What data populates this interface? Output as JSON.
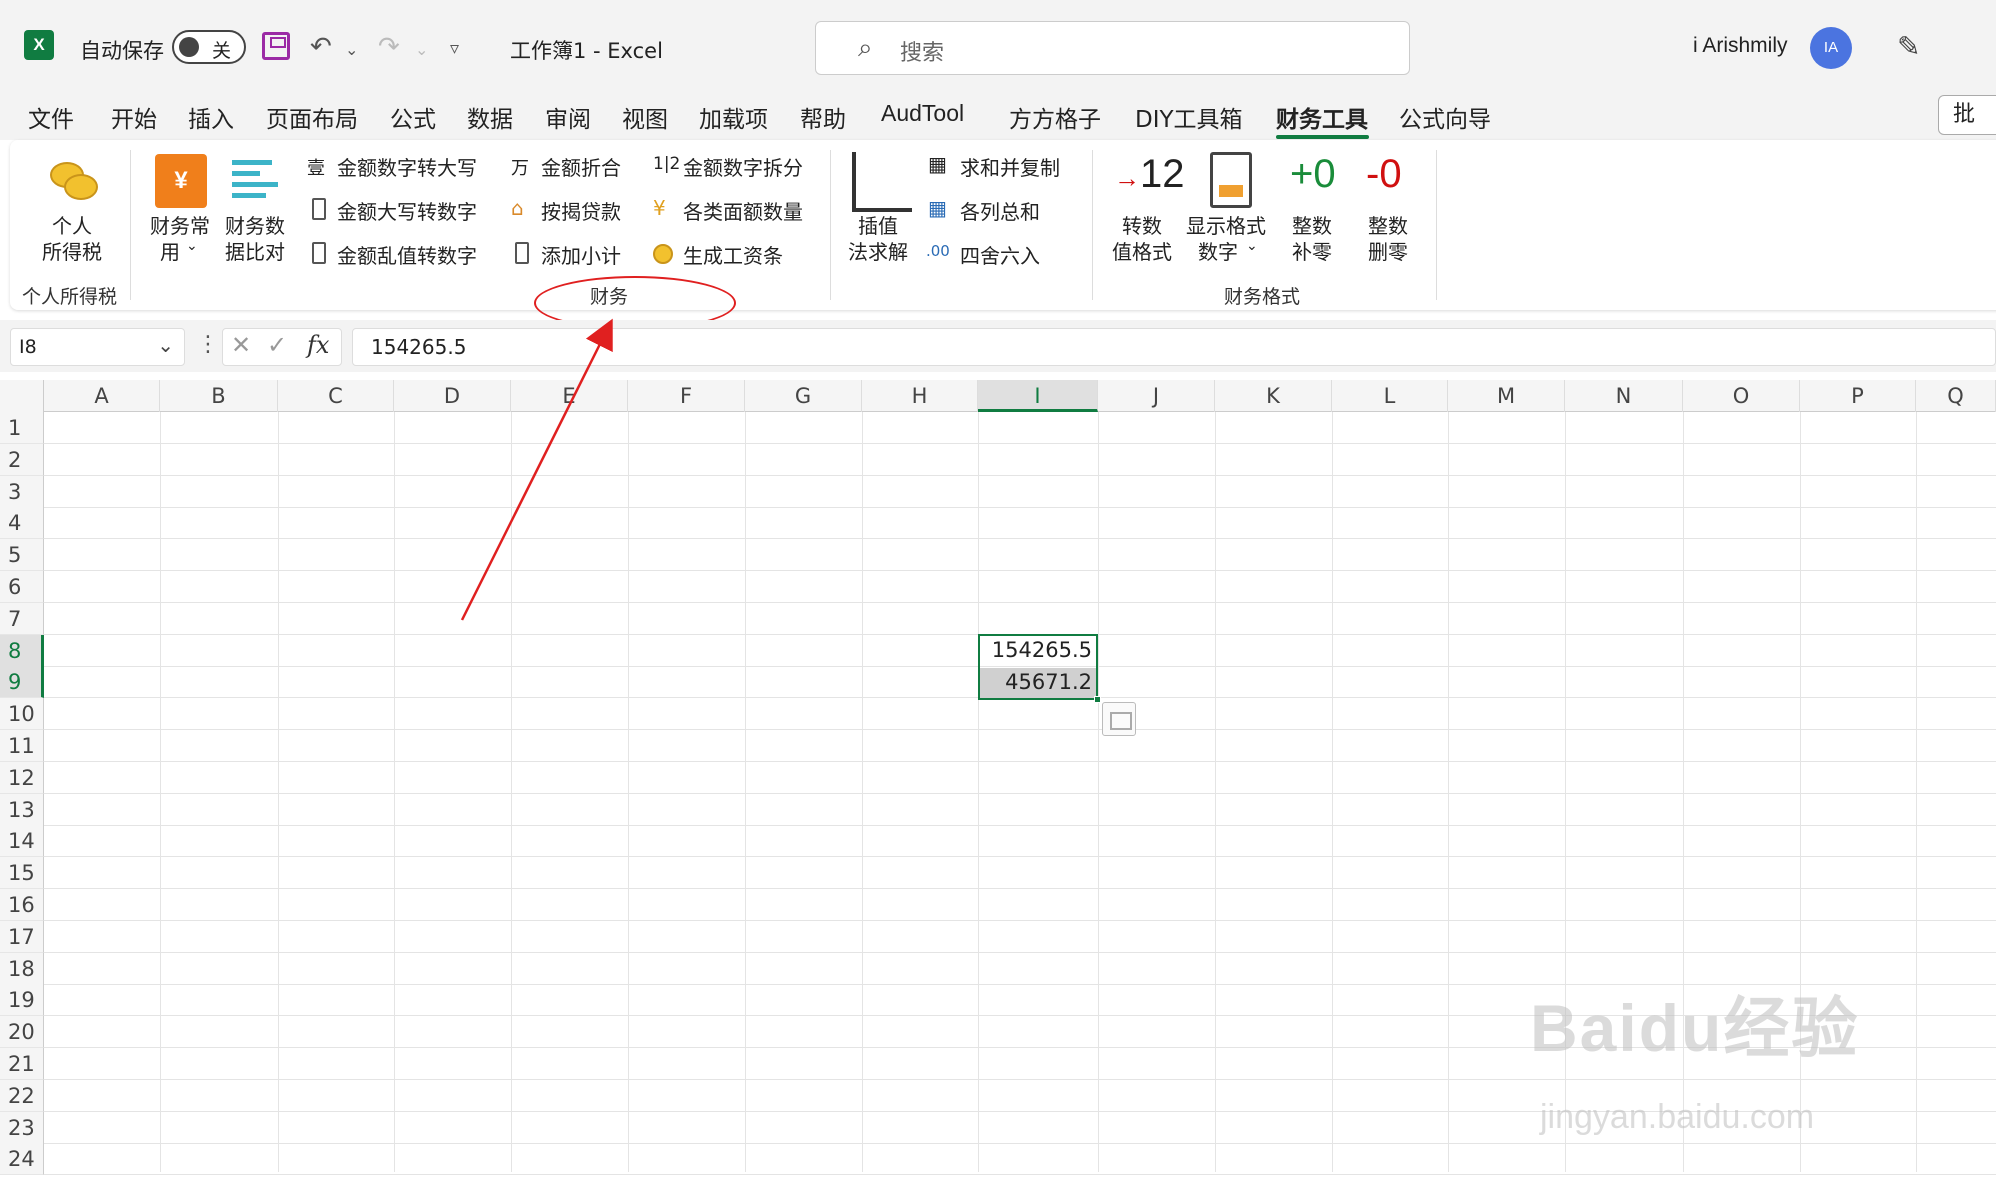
{
  "titlebar": {
    "logo": "X",
    "autosave_label": "自动保存",
    "autosave_state": "关",
    "doc_title": "工作簿1  -  Excel",
    "search_placeholder": "搜索",
    "user_name": "i Arishmily",
    "avatar_initials": "IA"
  },
  "menu": {
    "tabs": [
      "文件",
      "开始",
      "插入",
      "页面布局",
      "公式",
      "数据",
      "审阅",
      "视图",
      "加载项",
      "帮助",
      "AudTool",
      "方方格子",
      "DIY工具箱",
      "财务工具",
      "公式向导"
    ],
    "active_tab": "财务工具",
    "comment_label": "批"
  },
  "ribbon": {
    "group1": {
      "btn_label_1": "个人",
      "btn_label_2": "所得税",
      "label": "个人所得税"
    },
    "group2": {
      "common_1": "财务常",
      "common_2": "用",
      "compare_1": "财务数",
      "compare_2": "据比对",
      "col1": [
        "金额数字转大写",
        "金额大写转数字",
        "金额乱值转数字"
      ],
      "col2": [
        "金额折合",
        "按揭贷款",
        "添加小计"
      ],
      "col3": [
        "金额数字拆分",
        "各类面额数量",
        "生成工资条"
      ],
      "interp_1": "插值",
      "interp_2": "法求解",
      "col4": [
        "求和并复制",
        "各列总和",
        "四舍六入"
      ],
      "label": "财务"
    },
    "group3": {
      "b1_icon": "-12",
      "b1_1": "转数",
      "b1_2": "值格式",
      "b2_1": "显示格式",
      "b2_2": "数字",
      "b3_icon": "+0",
      "b3_1": "整数",
      "b3_2": "补零",
      "b4_icon": "-0",
      "b4_1": "整数",
      "b4_2": "删零",
      "label": "财务格式"
    },
    "icon_glyphs": {
      "daxie": "壹",
      "zhehe": "万",
      "chaifen": "1|2",
      "anjie": "⌂",
      "mianE": "¥",
      "sishe": ".00"
    }
  },
  "formula_bar": {
    "name_box": "I8",
    "formula": "154265.5"
  },
  "sheet": {
    "columns": [
      "A",
      "B",
      "C",
      "D",
      "E",
      "F",
      "G",
      "H",
      "I",
      "J",
      "K",
      "L",
      "M",
      "N",
      "O",
      "P",
      "Q"
    ],
    "selected_column": "I",
    "rows": [
      "1",
      "2",
      "3",
      "4",
      "5",
      "6",
      "7",
      "8",
      "9",
      "10",
      "11",
      "12",
      "13",
      "14",
      "15",
      "16",
      "17",
      "18",
      "19",
      "20",
      "21",
      "22",
      "23",
      "24"
    ],
    "selected_rows": [
      "8",
      "9"
    ],
    "cells": {
      "I8": "154265.5",
      "I9": "45671.2"
    }
  },
  "watermark": {
    "brand": "Baidu经验",
    "url": "jingyan.baidu.com"
  },
  "colors": {
    "excel_green": "#107c41",
    "annotation_red": "#e02020"
  }
}
